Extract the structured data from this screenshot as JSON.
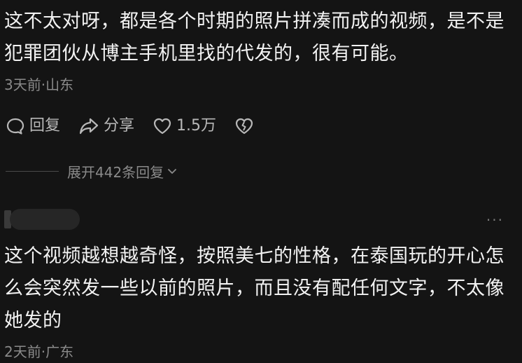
{
  "comment1": {
    "text": "这不太对呀，都是各个时期的照片拼凑而成的视频，是不是犯罪团伙从博主手机里找的代发的，很有可能。",
    "time_location": "3天前·山东",
    "actions": {
      "reply_label": "回复",
      "share_label": "分享",
      "like_count": "1.5万"
    },
    "expand_label": "展开442条回复"
  },
  "comment2": {
    "text": "这个视频越想越奇怪，按照美七的性格，在泰国玩的开心怎么会突然发一些以前的照片，而且没有配任何文字，不太像她发的",
    "time_location": "2天前·广东",
    "more_label": "···"
  },
  "icons": {
    "reply": "comment-bubble-icon",
    "share": "share-arrow-icon",
    "like": "heart-icon",
    "dislike": "broken-heart-icon",
    "expand": "chevron-down-icon"
  },
  "colors": {
    "background": "#141414",
    "text": "#f2f2f2",
    "secondary": "#8a8a8a",
    "action": "#b8b8b8"
  }
}
